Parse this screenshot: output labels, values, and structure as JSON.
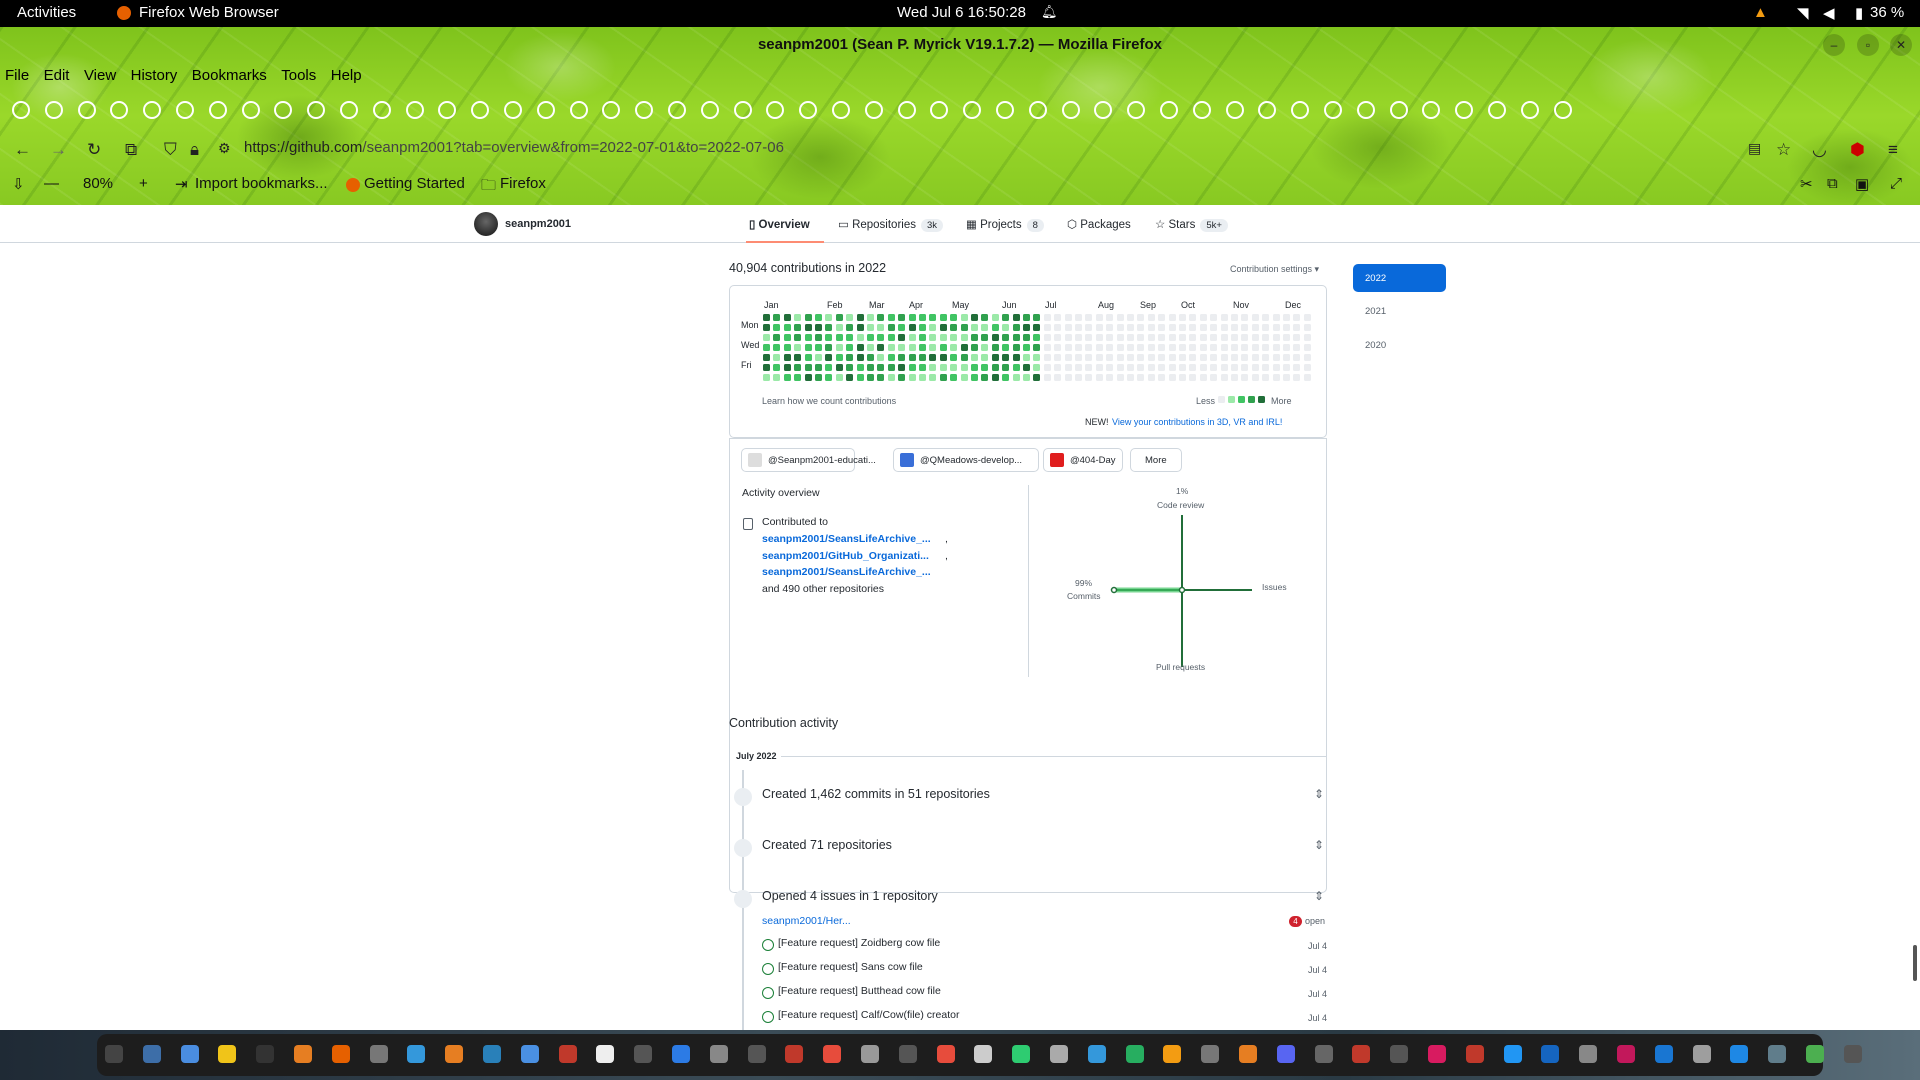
{
  "topbar": {
    "activities": "Activities",
    "app": "Firefox Web Browser",
    "clock": "Wed Jul 6  16:50:28",
    "battery": "36 %"
  },
  "window": {
    "title": "seanpm2001 (Sean P. Myrick V19.1.7.2) — Mozilla Firefox"
  },
  "menu": [
    "File",
    "Edit",
    "View",
    "History",
    "Bookmarks",
    "Tools",
    "Help"
  ],
  "navbar": {
    "url_host": "https://github.com",
    "url_path": "/seanpm2001?tab=overview&from=2022-07-01&to=2022-07-06",
    "zoom": "80%"
  },
  "bookmarks_bar": {
    "import": "Import bookmarks...",
    "getting_started": "Getting Started",
    "firefox_folder": "Firefox"
  },
  "profile": {
    "username": "seanpm2001",
    "tabs": [
      {
        "label": "Overview",
        "count": ""
      },
      {
        "label": "Repositories",
        "count": "3k"
      },
      {
        "label": "Projects",
        "count": "8"
      },
      {
        "label": "Packages",
        "count": ""
      },
      {
        "label": "Stars",
        "count": "5k+"
      }
    ]
  },
  "contributions": {
    "heading": "40,904 contributions in 2022",
    "settings": "Contribution settings ▾",
    "months": [
      "Jan",
      "Feb",
      "Mar",
      "Apr",
      "May",
      "Jun",
      "Jul",
      "Aug",
      "Sep",
      "Oct",
      "Nov",
      "Dec"
    ],
    "days": [
      "Mon",
      "Wed",
      "Fri"
    ],
    "learn": "Learn how we count contributions",
    "less": "Less",
    "more": "More",
    "new_label": "NEW!",
    "new_link": "View your contributions in 3D, VR and IRL!",
    "filled_weeks": 27
  },
  "years": [
    "2022",
    "2021",
    "2020"
  ],
  "orgs": [
    "@Seanpm2001-educati...",
    "@QMeadows-develop...",
    "@404-Day",
    "More"
  ],
  "activity_overview": {
    "title": "Activity overview",
    "contributed_to": "Contributed to",
    "repos": [
      "seanpm2001/SeansLifeArchive_...",
      "seanpm2001/GitHub_Organizati...",
      "seanpm2001/SeansLifeArchive_..."
    ],
    "other": "and 490 other repositories",
    "axes": {
      "code_review_pct": "1%",
      "code_review": "Code review",
      "commits_pct": "99%",
      "commits": "Commits",
      "issues": "Issues",
      "pull_requests": "Pull requests"
    }
  },
  "contribution_activity": {
    "title": "Contribution activity",
    "month": "July 2022",
    "items": [
      "Created 1,462 commits in 51 repositories",
      "Created 71 repositories",
      "Opened 4 issues in 1 repository"
    ],
    "issue_repo": "seanpm2001/Her...",
    "open_count": "4",
    "open_label": "open",
    "issues": [
      {
        "title": "[Feature request] Zoidberg cow file",
        "date": "Jul 4"
      },
      {
        "title": "[Feature request] Sans cow file",
        "date": "Jul 4"
      },
      {
        "title": "[Feature request] Butthead cow file",
        "date": "Jul 4"
      },
      {
        "title": "[Feature request] Calf/Cow(file) creator",
        "date": "Jul 4"
      }
    ]
  },
  "colors": {
    "accent": "#0969da",
    "green1": "#9be9a8",
    "green2": "#40c463",
    "green3": "#30a14e",
    "green4": "#216e39",
    "empty": "#ebedf0"
  }
}
